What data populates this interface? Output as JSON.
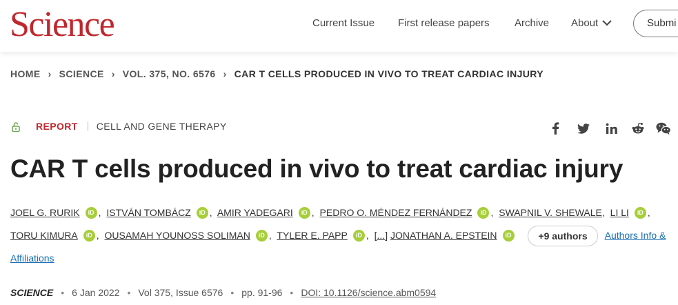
{
  "header": {
    "logo": "Science",
    "nav": [
      "Current Issue",
      "First release papers",
      "Archive",
      "About"
    ],
    "submit_label": "Submi"
  },
  "breadcrumb": [
    "HOME",
    "SCIENCE",
    "VOL. 375, NO. 6576",
    "CAR T CELLS PRODUCED IN VIVO TO TREAT CARDIAC INJURY"
  ],
  "article": {
    "type": "REPORT",
    "subject": "CELL AND GENE THERAPY",
    "title": "CAR T cells produced in vivo to treat cardiac injury",
    "authors": [
      "JOEL G. RURIK",
      "ISTVÁN TOMBÁCZ",
      "AMIR YADEGARI",
      "PEDRO O. MÉNDEZ FERNÁNDEZ",
      "SWAPNIL V. SHEWALE",
      "LI LI",
      "TORU KIMURA",
      "OUSAMAH YOUNOSS SOLIMAN",
      "TYLER E. PAPP",
      "[...]",
      "JONATHAN A. EPSTEIN"
    ],
    "more_authors": "+9 authors",
    "affiliations_label": "Authors Info & Affiliations",
    "orcid_label": "iD"
  },
  "citation": {
    "journal": "SCIENCE",
    "date": "6 Jan 2022",
    "volume": "Vol 375, Issue 6576",
    "pages": "pp. 91-96",
    "doi": "DOI: 10.1126/science.abm0594"
  },
  "share_icons": [
    "facebook-icon",
    "twitter-icon",
    "linkedin-icon",
    "reddit-icon",
    "wechat-icon"
  ],
  "colors": {
    "brand": "#c0272d",
    "orcid": "#a6ce39",
    "link": "#1a6fb4"
  }
}
